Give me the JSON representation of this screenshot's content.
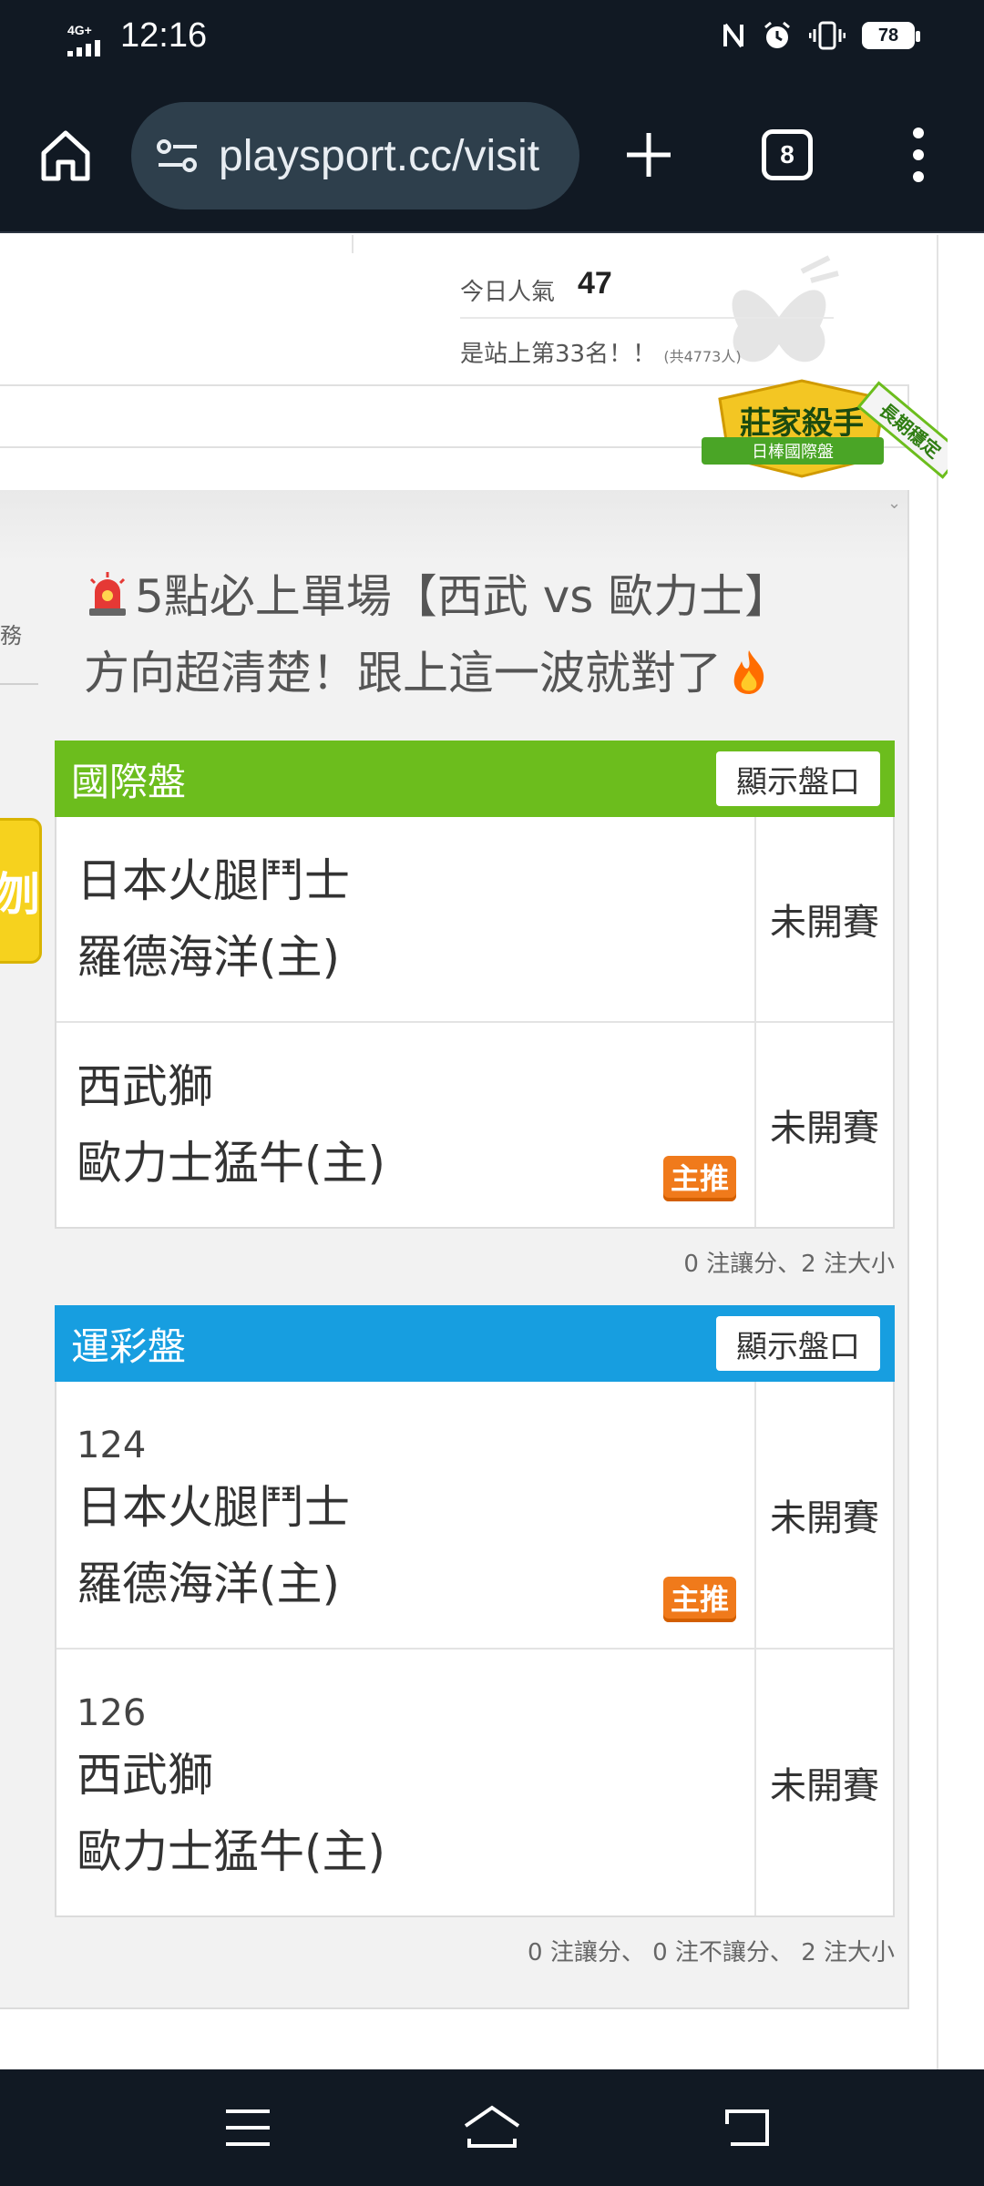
{
  "status_bar": {
    "network": "4G+",
    "time": "12:16",
    "battery": "78"
  },
  "browser": {
    "url": "playsport.cc/visit",
    "tab_count": "8"
  },
  "page": {
    "popularity_label": "今日人氣",
    "popularity_value": "47",
    "rank_text": "是站上第33名！！",
    "rank_total": "(共4773人)",
    "badge": {
      "title": "莊家殺手",
      "subtitle": "日棒國際盤",
      "ribbon": "長期穩定"
    },
    "side_tab_char": "刎",
    "headline_line1": "5點必上單場【西武 vs 歐力士】",
    "headline_line2": "方向超清楚！跟上這一波就對了",
    "intl_section": {
      "title": "國際盤",
      "show_button": "顯示盤口",
      "rows": [
        {
          "team1": "日本火腿鬥士",
          "team2": "羅德海洋(主)",
          "status": "未開賽",
          "recommend": ""
        },
        {
          "team1": "西武獅",
          "team2": "歐力士猛牛(主)",
          "status": "未開賽",
          "recommend": "主推"
        }
      ],
      "summary": "0 注讓分、2 注大小"
    },
    "lottery_section": {
      "title": "運彩盤",
      "show_button": "顯示盤口",
      "rows": [
        {
          "number": "124",
          "team1": "日本火腿鬥士",
          "team2": "羅德海洋(主)",
          "status": "未開賽",
          "recommend": "主推"
        },
        {
          "number": "126",
          "team1": "西武獅",
          "team2": "歐力士猛牛(主)",
          "status": "未開賽",
          "recommend": ""
        }
      ],
      "summary": "0 注讓分、 0 注不讓分、 2 注大小"
    }
  },
  "colors": {
    "intl_header": "#6cbd1d",
    "lottery_header": "#179ee0",
    "recommend_badge": "#f07a1b",
    "chrome": "#111923"
  }
}
